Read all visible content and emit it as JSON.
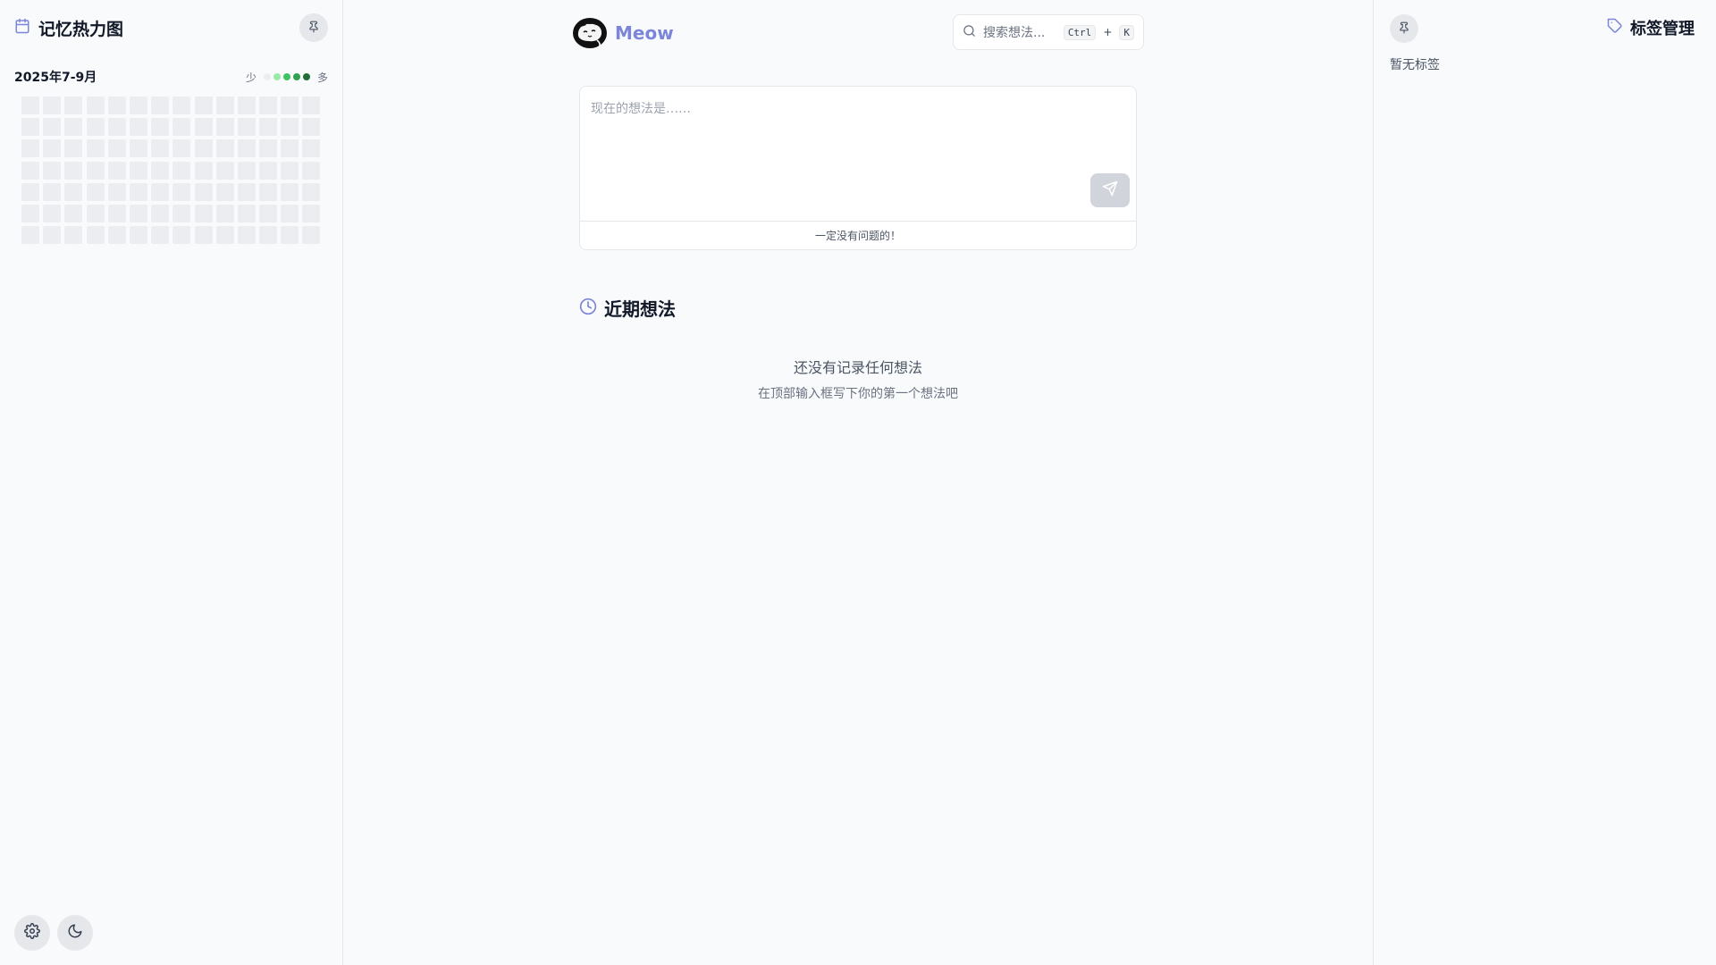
{
  "colors": {
    "accent": "#7c86d9",
    "heatmap_empty": "#ebedf0",
    "heatmap_levels": [
      "#ebedf0",
      "#9be9a8",
      "#40c463",
      "#30a14e",
      "#216e39"
    ]
  },
  "left_sidebar": {
    "title": "记忆热力图",
    "title_icon": "calendar-icon",
    "pin_icon": "pin-icon",
    "heatmap": {
      "range_label": "2025年7-9月",
      "legend_less": "少",
      "legend_more": "多",
      "columns": 14,
      "rows": 7,
      "values": []
    },
    "bottom_buttons": [
      {
        "icon": "gear-icon"
      },
      {
        "icon": "moon-icon"
      }
    ]
  },
  "main": {
    "brand": {
      "name": "Meow",
      "logo_icon": "cat-logo-icon"
    },
    "search": {
      "placeholder": "搜索想法...",
      "shortcut_key1": "Ctrl",
      "shortcut_plus": "+",
      "shortcut_key2": "K",
      "icon": "search-icon"
    },
    "composer": {
      "placeholder": "现在的想法是……",
      "value": "",
      "footer_text": "一定没有问题的！",
      "send_icon": "send-icon"
    },
    "recent": {
      "title": "近期想法",
      "icon": "clock-icon",
      "empty_title": "还没有记录任何想法",
      "empty_subtitle": "在顶部输入框写下你的第一个想法吧"
    }
  },
  "right_sidebar": {
    "title": "标签管理",
    "title_icon": "tag-icon",
    "pin_icon": "pin-icon",
    "empty_text": "暂无标签"
  }
}
